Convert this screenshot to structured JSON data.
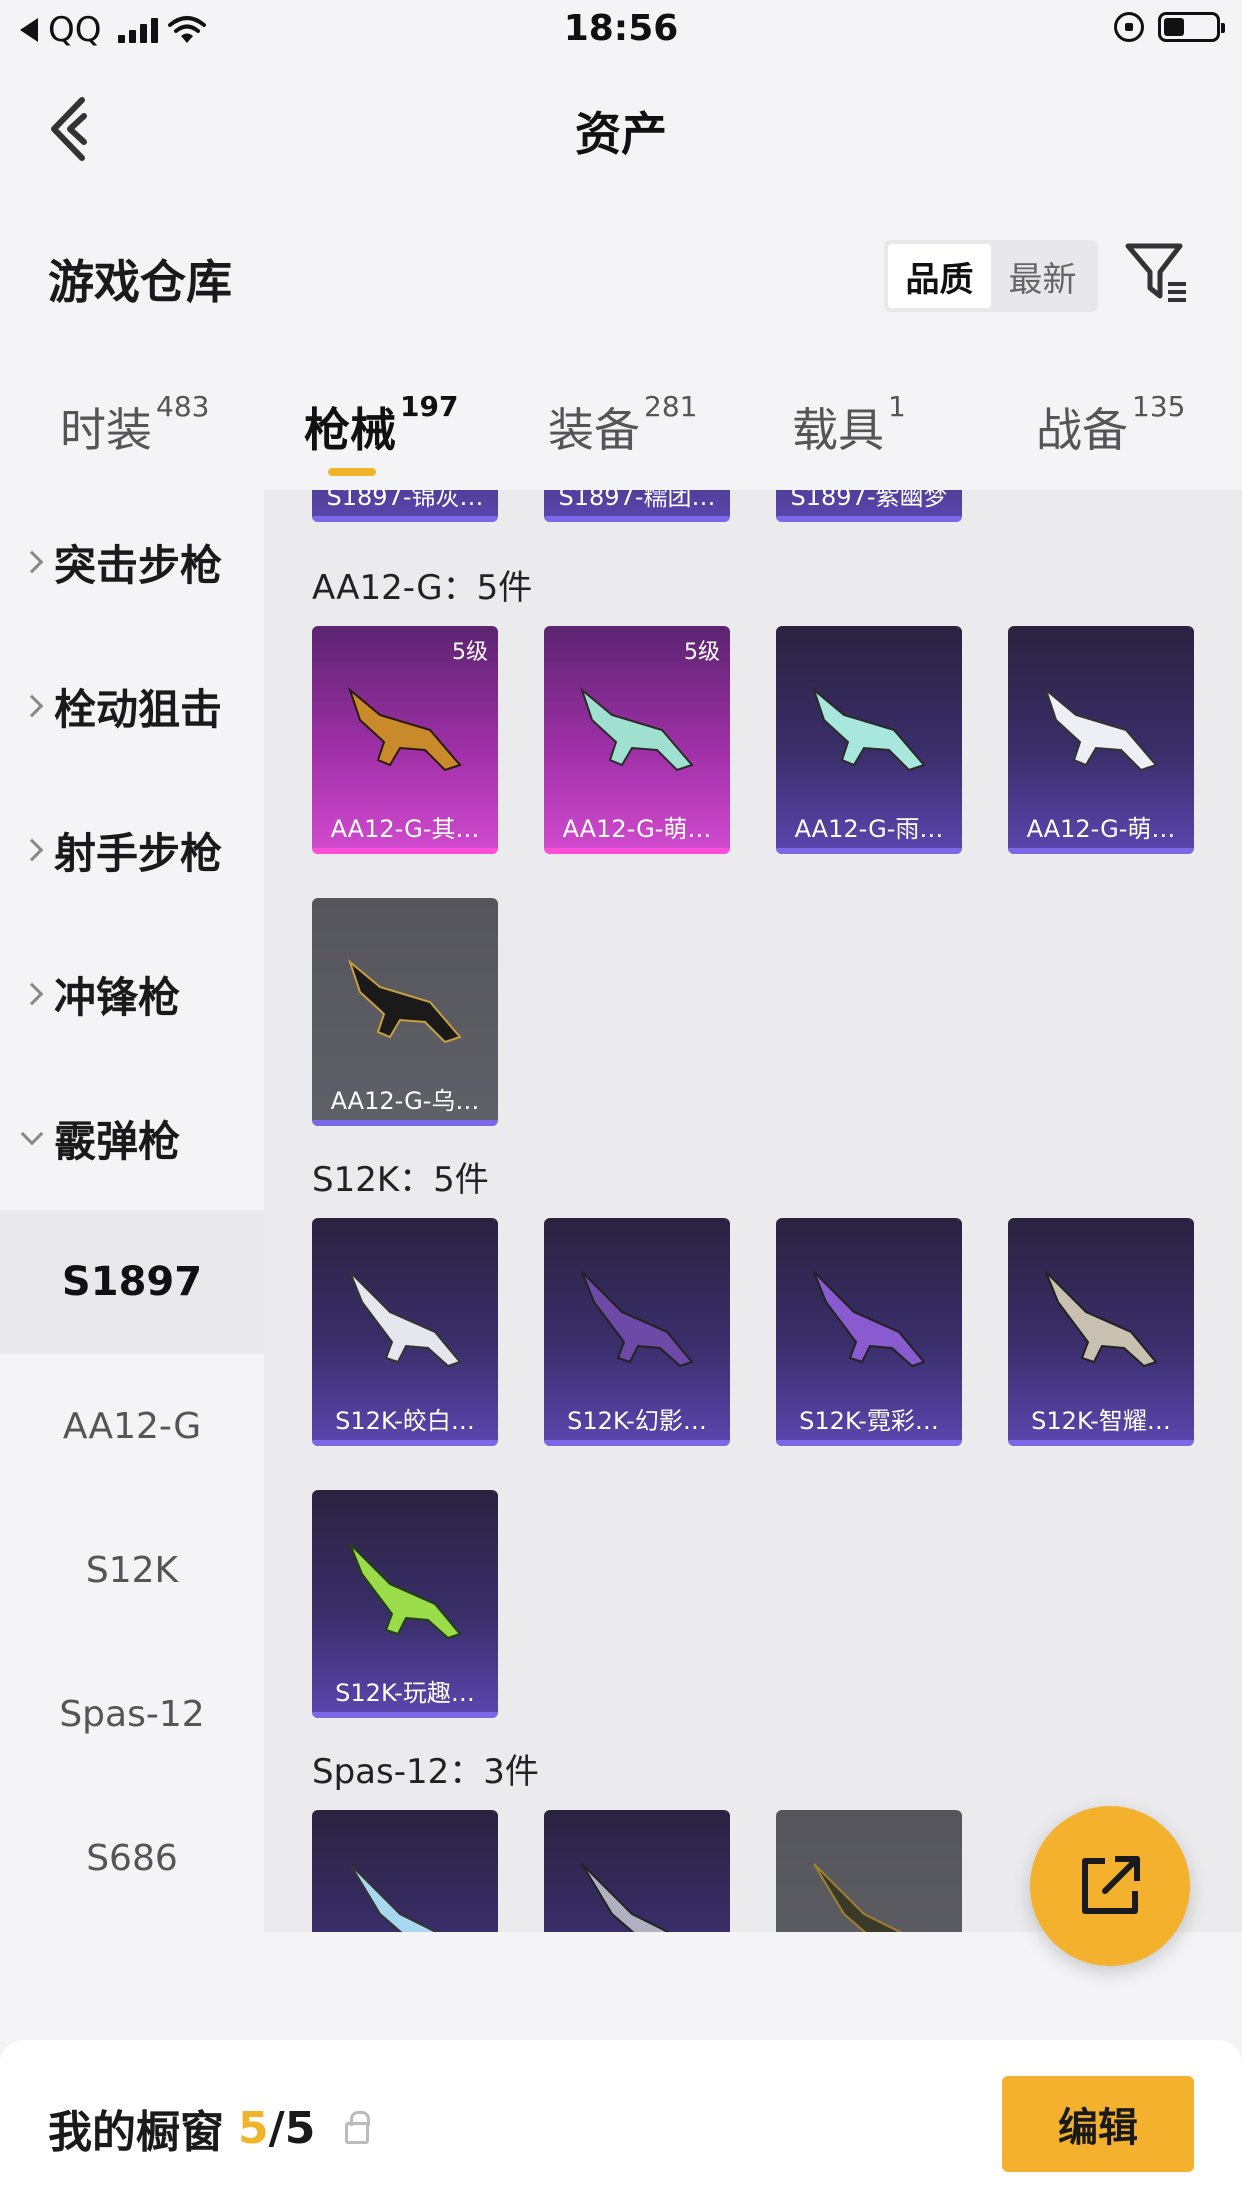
{
  "status_bar": {
    "carrier": "QQ",
    "time": "18:56"
  },
  "nav": {
    "title": "资产"
  },
  "warehouse": {
    "title": "游戏仓库",
    "sort_options": [
      "品质",
      "最新"
    ],
    "sort_active": "品质"
  },
  "tabs": [
    {
      "label": "时装",
      "count": "483"
    },
    {
      "label": "枪械",
      "count": "197",
      "active": true
    },
    {
      "label": "装备",
      "count": "281"
    },
    {
      "label": "载具",
      "count": "1"
    },
    {
      "label": "战备",
      "count": "135"
    }
  ],
  "sidebar": {
    "categories": [
      "突击步枪",
      "栓动狙击",
      "射手步枪",
      "冲锋枪",
      "霰弹枪"
    ],
    "subcategories": [
      "S1897",
      "AA12-G",
      "S12K",
      "Spas-12",
      "S686"
    ],
    "active_sub": "S1897"
  },
  "content": {
    "partial_row": [
      "S1897-锦灰…",
      "S1897-糯团…",
      "S1897-紫幽梦"
    ],
    "groups": [
      {
        "title": "AA12-G：5件",
        "items": [
          {
            "label": "AA12-G-其…",
            "rarity": "pink",
            "level": "5级"
          },
          {
            "label": "AA12-G-萌…",
            "rarity": "pink",
            "level": "5级"
          },
          {
            "label": "AA12-G-雨…",
            "rarity": "purple"
          },
          {
            "label": "AA12-G-萌…",
            "rarity": "purple"
          },
          {
            "label": "AA12-G-乌…",
            "rarity": "gray"
          }
        ]
      },
      {
        "title": "S12K：5件",
        "items": [
          {
            "label": "S12K-皎白…",
            "rarity": "purple"
          },
          {
            "label": "S12K-幻影…",
            "rarity": "purple"
          },
          {
            "label": "S12K-霓彩…",
            "rarity": "purple"
          },
          {
            "label": "S12K-智耀…",
            "rarity": "purple"
          },
          {
            "label": "S12K-玩趣…",
            "rarity": "purple"
          }
        ]
      },
      {
        "title": "Spas-12：3件",
        "items": [
          {
            "rarity": "purple"
          },
          {
            "rarity": "purple"
          },
          {
            "rarity": "gray"
          }
        ]
      }
    ]
  },
  "bottom_bar": {
    "showcase_label": "我的橱窗",
    "showcase_count": "5",
    "showcase_total": "/5",
    "edit_label": "编辑"
  },
  "colors": {
    "accent": "#f3b12e",
    "rarity_pink": "#d24bcf",
    "rarity_purple": "#5a47b0",
    "rarity_gray": "#606068"
  }
}
